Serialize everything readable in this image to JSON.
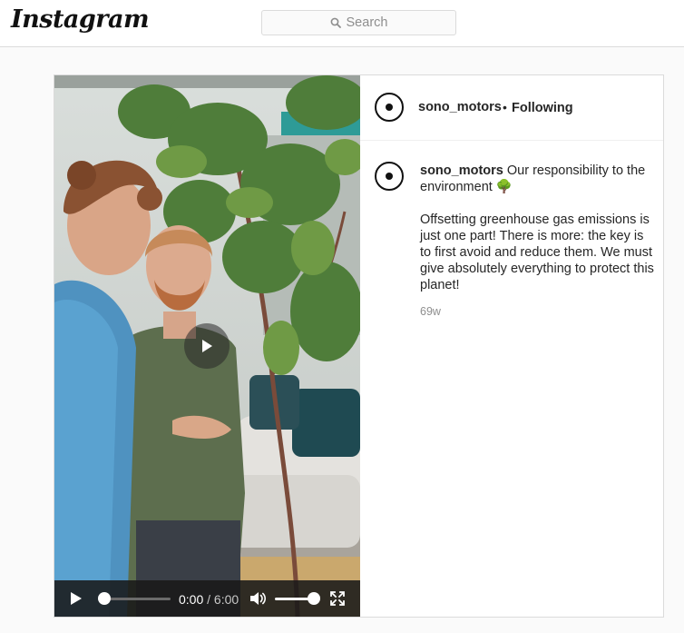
{
  "nav": {
    "logo": "Instagram",
    "search": {
      "placeholder": "Search"
    }
  },
  "post": {
    "username": "sono_motors",
    "header_separator": "•",
    "follow_status": "Following",
    "caption": {
      "username": "sono_motors",
      "title": "Our responsibility to the environment 🌳",
      "body": "Offsetting greenhouse gas emissions is just one part! There is more: the key is to first avoid and reduce them. We must give absolutely everything to protect this planet!"
    },
    "timestamp": "69w"
  },
  "video": {
    "current_time": "0:00",
    "time_separator": "/",
    "duration": "6:00",
    "progress": 0,
    "volume": 1,
    "icons": {
      "play_overlay": "play-icon",
      "play_control": "play-icon",
      "volume": "speaker-icon",
      "fullscreen": "fullscreen-icon"
    }
  },
  "colors": {
    "border": "#dbdbdb",
    "text": "#262626",
    "secondary_text": "#8e8e8e",
    "background": "#fafafa"
  }
}
